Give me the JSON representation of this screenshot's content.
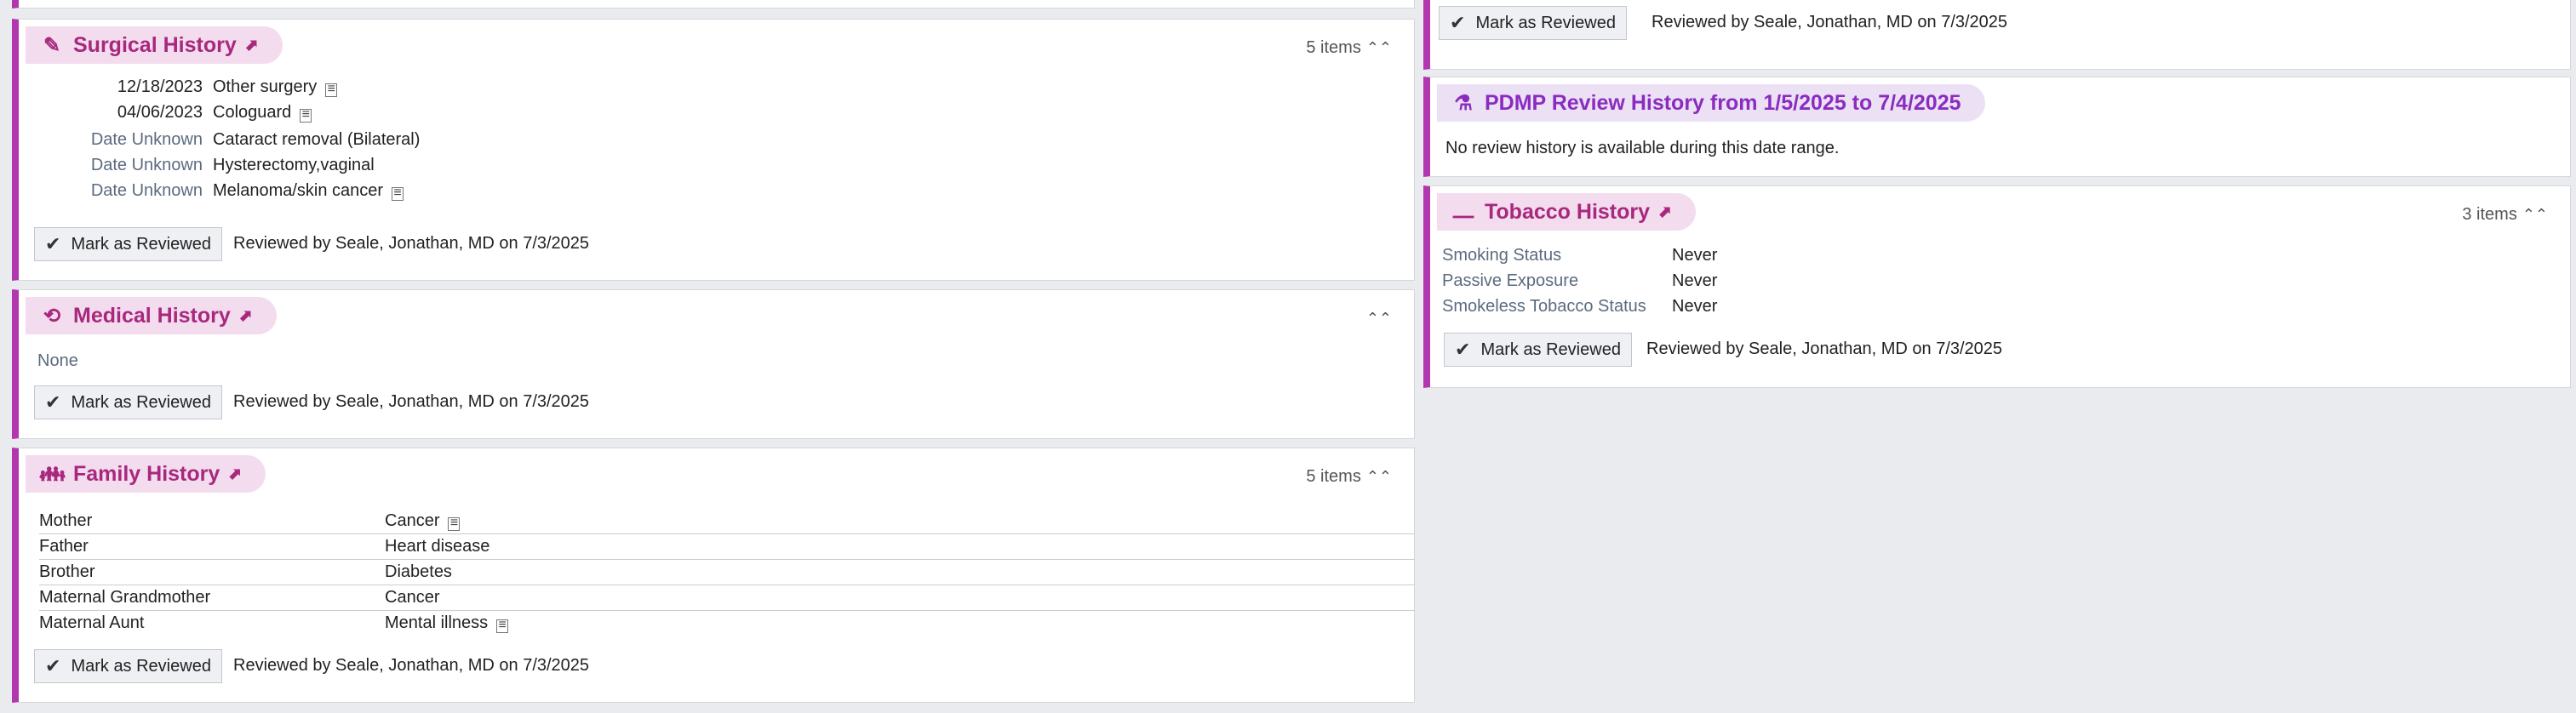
{
  "surgical": {
    "title": "Surgical History",
    "count": "5 items",
    "items": [
      {
        "date": "12/18/2023",
        "desc": "Other surgery"
      },
      {
        "date": "04/06/2023",
        "desc": "Cologuard"
      },
      {
        "date": "Date Unknown",
        "desc": "Cataract removal (Bilateral)"
      },
      {
        "date": "Date Unknown",
        "desc": "Hysterectomy,vaginal"
      },
      {
        "date": "Date Unknown",
        "desc": "Melanoma/skin cancer"
      }
    ],
    "mark_label": "Mark as Reviewed",
    "reviewed": "Reviewed by Seale, Jonathan, MD on 7/3/2025"
  },
  "medical": {
    "title": "Medical History",
    "none_text": "None",
    "mark_label": "Mark as Reviewed",
    "reviewed": "Reviewed by Seale, Jonathan, MD on 7/3/2025"
  },
  "family": {
    "title": "Family History",
    "count": "5 items",
    "rows": [
      {
        "relation": "Mother",
        "condition": "Cancer"
      },
      {
        "relation": "Father",
        "condition": "Heart disease"
      },
      {
        "relation": "Brother",
        "condition": "Diabetes"
      },
      {
        "relation": "Maternal Grandmother",
        "condition": "Cancer"
      },
      {
        "relation": "Maternal Aunt",
        "condition": "Mental illness"
      }
    ],
    "mark_label": "Mark as Reviewed",
    "reviewed": "Reviewed by Seale, Jonathan, MD on 7/3/2025"
  },
  "top_right": {
    "mark_label": "Mark as Reviewed",
    "reviewed": "Reviewed by Seale, Jonathan, MD on 7/3/2025"
  },
  "pdmp": {
    "title": "PDMP Review History from 1/5/2025 to 7/4/2025",
    "message": "No review history is available during this date range."
  },
  "tobacco": {
    "title": "Tobacco History",
    "count": "3 items",
    "fields": [
      {
        "label": "Smoking Status",
        "value": "Never"
      },
      {
        "label": "Passive Exposure",
        "value": "Never"
      },
      {
        "label": "Smokeless Tobacco Status",
        "value": "Never"
      }
    ],
    "mark_label": "Mark as Reviewed",
    "reviewed": "Reviewed by Seale, Jonathan, MD on 7/3/2025"
  },
  "colors": {
    "accent_border": "#b236ae",
    "pill_pink": "#f3dcee",
    "pill_purple": "#ece0f5",
    "title_pink": "#a8287e",
    "title_purple": "#8a2cc0"
  },
  "icons": {
    "surgical": "scalpel-icon",
    "medical": "history-icon",
    "family": "people-icon",
    "pdmp": "mortar-pestle-icon",
    "tobacco": "cigarette-icon",
    "external": "external-link-icon",
    "collapse": "double-chevron-up-icon",
    "note": "document-icon",
    "check": "checkmark-icon"
  }
}
